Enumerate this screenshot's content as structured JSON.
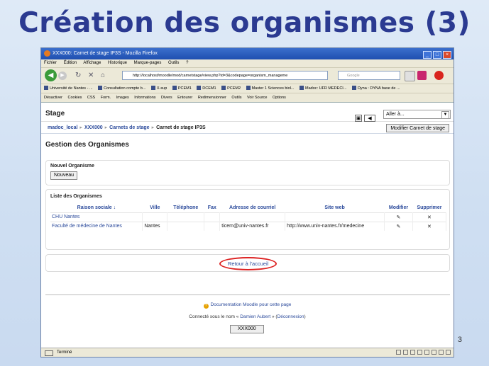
{
  "slide": {
    "title": "Création des organismes (3)",
    "page_number": "3"
  },
  "browser": {
    "window_title": "XXX000: Carnet de stage IP3S - Mozilla Firefox",
    "menu": [
      "Fichier",
      "Édition",
      "Affichage",
      "Historique",
      "Marque-pages",
      "Outils",
      "?"
    ],
    "url": "http://localhost/moodle/mod/carnetstage/view.php?id=3&codepage=organism_manageme",
    "search_placeholder": "Google",
    "bookmarks": [
      "Université de Nantes - ...",
      "Consultation compte b...",
      "X-sup",
      "PCEM1",
      "DCEM1",
      "PCEM2",
      "Master 1 Sciences biol...",
      "Madoc: UFR MEDECI...",
      "Dyna : DYNA base de ..."
    ],
    "addons": [
      "Désactiver",
      "Cookies",
      "CSS",
      "Form.",
      "Images",
      "Informations",
      "Divers",
      "Entourer",
      "Redimensionner",
      "Outils",
      "Voir Source",
      "Options"
    ],
    "status": "Terminé"
  },
  "page": {
    "header": "Stage",
    "jump_select": "Aller à...",
    "breadcrumb": [
      "madoc_local",
      "XXX000",
      "Carnets de stage",
      "Carnet de stage IP3S"
    ],
    "edit_button": "Modifier Carnet de stage",
    "section_title": "Gestion des Organismes",
    "new_org": {
      "label": "Nouvel Organisme",
      "button": "Nouveau"
    },
    "list": {
      "label": "Liste des Organismes",
      "columns": [
        "Raison sociale ↓",
        "Ville",
        "Téléphone",
        "Fax",
        "Adresse de courriel",
        "Site web",
        "Modifier",
        "Supprimer"
      ],
      "rows": [
        {
          "name": "CHU Nantes",
          "city": "",
          "phone": "",
          "fax": "",
          "email": "",
          "web": "",
          "edit": "✎",
          "delete": "✕"
        },
        {
          "name": "Faculté de médecine de Nantes",
          "city": "Nantes",
          "phone": "",
          "fax": "",
          "email": "ticem@univ-nantes.fr",
          "web": "http://www.univ-nantes.fr/medecine",
          "edit": "✎",
          "delete": "✕"
        }
      ]
    },
    "back_link": "Retour à l'accueil",
    "doc_link": "Documentation Moodle pour cette page",
    "logged_prefix": "Connecté sous le nom «",
    "user_name": "Damien Aubert",
    "logged_mid": "» (",
    "logout": "Déconnexion",
    "logged_suffix": ")",
    "home_button": "XXX000"
  }
}
